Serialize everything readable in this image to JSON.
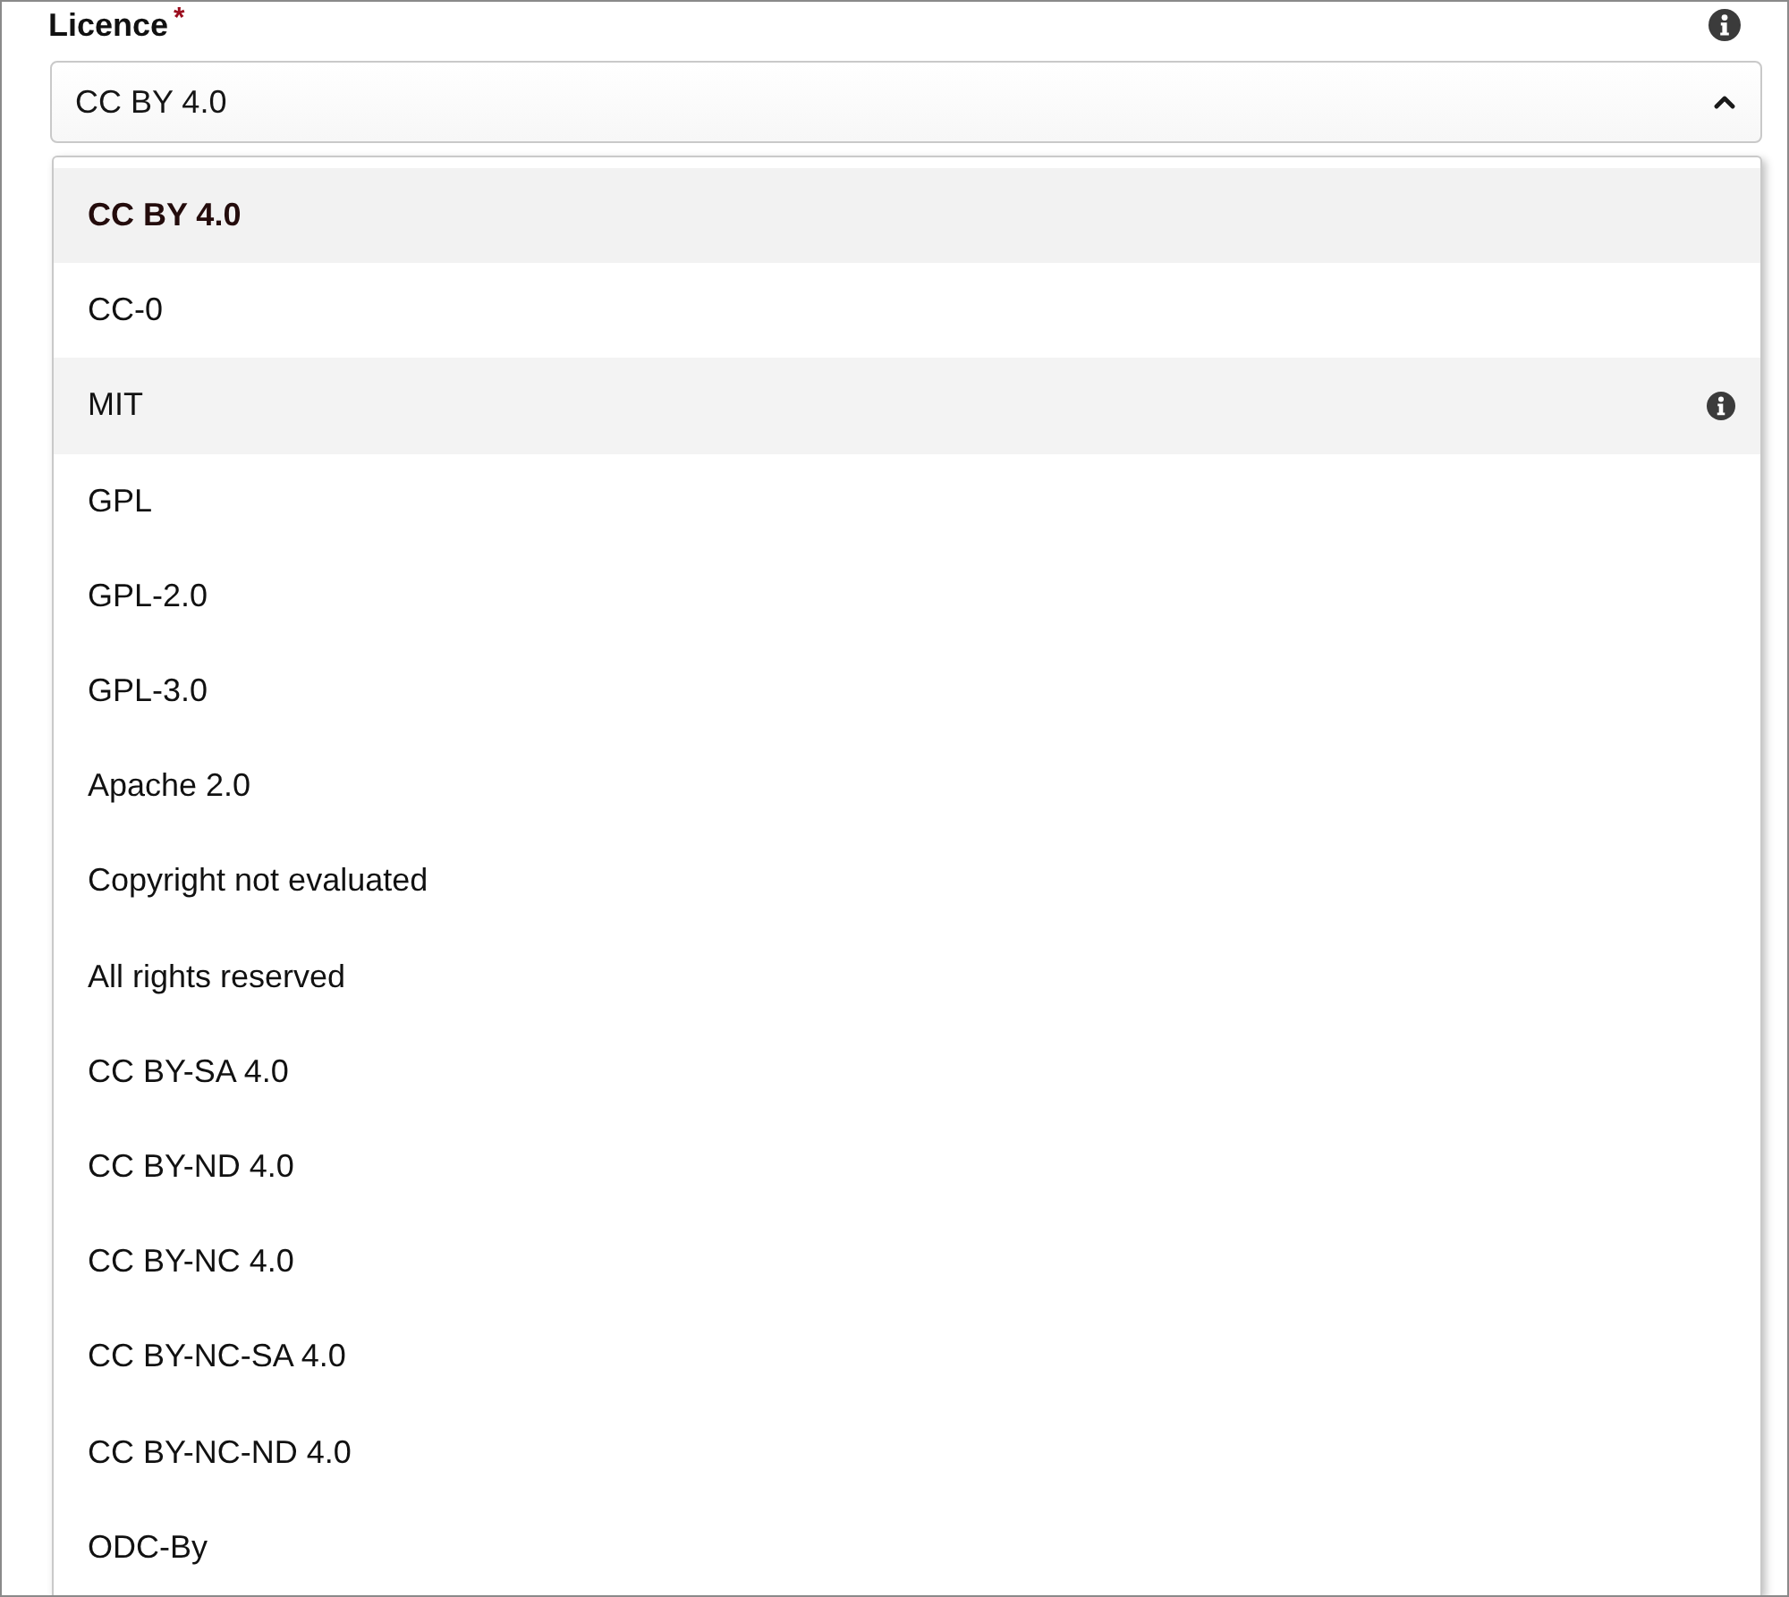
{
  "field": {
    "label": "Licence",
    "required_mark": "*",
    "value": "CC BY 4.0",
    "expanded": true
  },
  "dropdown": {
    "options": [
      {
        "label": "CC BY 4.0",
        "selected": true,
        "highlighted": false
      },
      {
        "label": "CC-0",
        "selected": false,
        "highlighted": false
      },
      {
        "label": "MIT",
        "selected": false,
        "highlighted": true
      },
      {
        "label": "GPL",
        "selected": false,
        "highlighted": false
      },
      {
        "label": "GPL-2.0",
        "selected": false,
        "highlighted": false
      },
      {
        "label": "GPL-3.0",
        "selected": false,
        "highlighted": false
      },
      {
        "label": "Apache 2.0",
        "selected": false,
        "highlighted": false
      },
      {
        "label": "Copyright not evaluated",
        "selected": false,
        "highlighted": false
      },
      {
        "label": "All rights reserved",
        "selected": false,
        "highlighted": false
      },
      {
        "label": "CC BY-SA 4.0",
        "selected": false,
        "highlighted": false
      },
      {
        "label": "CC BY-ND 4.0",
        "selected": false,
        "highlighted": false
      },
      {
        "label": "CC BY-NC 4.0",
        "selected": false,
        "highlighted": false
      },
      {
        "label": "CC BY-NC-SA 4.0",
        "selected": false,
        "highlighted": false
      },
      {
        "label": "CC BY-NC-ND 4.0",
        "selected": false,
        "highlighted": false
      },
      {
        "label": "ODC-By",
        "selected": false,
        "highlighted": false
      }
    ]
  }
}
